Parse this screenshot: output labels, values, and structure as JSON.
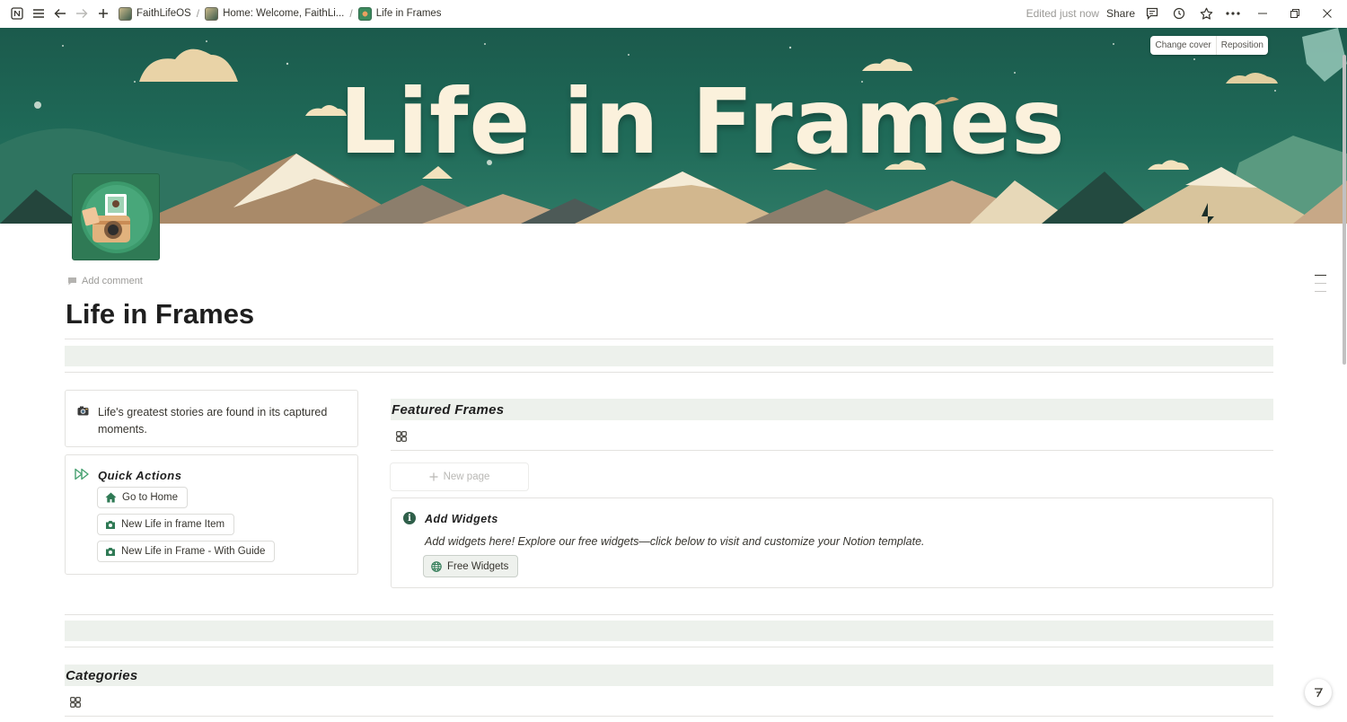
{
  "topbar": {
    "breadcrumbs": [
      {
        "label": "FaithLifeOS"
      },
      {
        "label": "Home: Welcome, FaithLi..."
      },
      {
        "label": "Life in Frames"
      }
    ],
    "edited": "Edited just now",
    "share": "Share"
  },
  "cover": {
    "title": "Life in Frames",
    "change_cover": "Change cover",
    "reposition": "Reposition"
  },
  "page": {
    "add_comment": "Add comment",
    "title": "Life in Frames"
  },
  "quote": {
    "icon": "camera-emoji",
    "text": "Life's greatest stories are found in its captured moments."
  },
  "quick_actions": {
    "title": "Quick Actions",
    "buttons": [
      {
        "label": "Go to Home",
        "icon": "home-icon"
      },
      {
        "label": "New Life in frame Item",
        "icon": "camera-icon"
      },
      {
        "label": "New Life in Frame - With Guide",
        "icon": "camera-icon"
      }
    ]
  },
  "featured": {
    "title": "Featured Frames",
    "new_page": "New page"
  },
  "widgets": {
    "title": "Add Widgets",
    "description": "Add widgets here! Explore our free widgets—click below to visit and customize your Notion template.",
    "button": "Free Widgets"
  },
  "categories": {
    "title": "Categories"
  },
  "colors": {
    "accent_green": "#2f7a55",
    "band": "#edf1ec",
    "cover_bg": "#1f6a58"
  }
}
